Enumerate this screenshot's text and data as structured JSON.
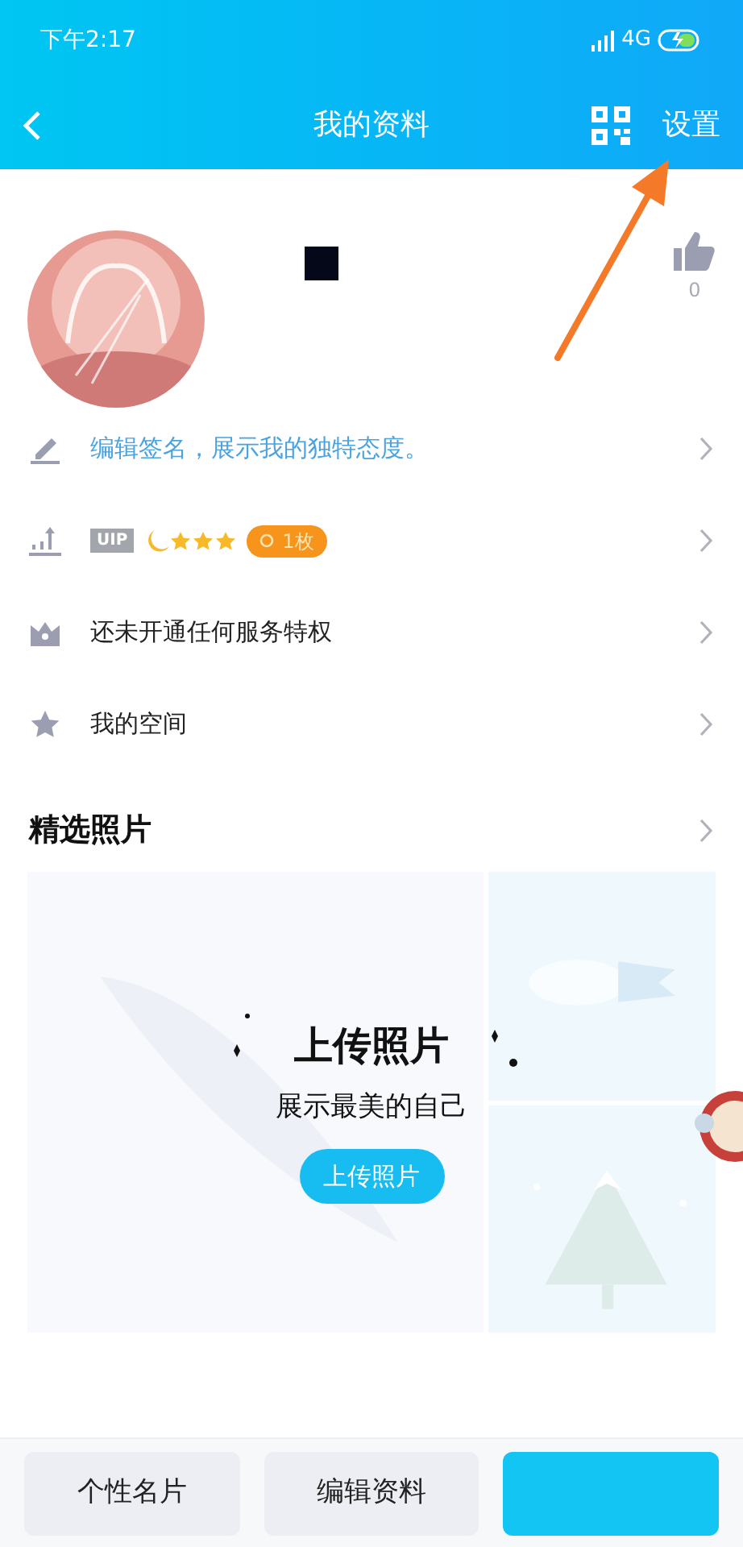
{
  "status_bar": {
    "time": "下午2:17",
    "network": "4G"
  },
  "nav": {
    "title": "我的资料",
    "action": "设置"
  },
  "profile": {
    "likes": "0"
  },
  "rows": [
    {
      "kind": "signature",
      "text": "编辑签名，展示我的独特态度。"
    },
    {
      "kind": "vip",
      "vip_label": "UIP",
      "stars": 3,
      "badge": "1枚"
    },
    {
      "kind": "privilege",
      "text": "还未开通任何服务特权"
    },
    {
      "kind": "space",
      "text": "我的空间"
    }
  ],
  "photos": {
    "title": "精选照片",
    "heading": "上传照片",
    "subtitle": "展示最美的自己",
    "button": "上传照片"
  },
  "bottom_buttons": [
    {
      "label": "个性名片",
      "primary": false
    },
    {
      "label": "编辑资料",
      "primary": false
    },
    {
      "primary": true
    }
  ]
}
